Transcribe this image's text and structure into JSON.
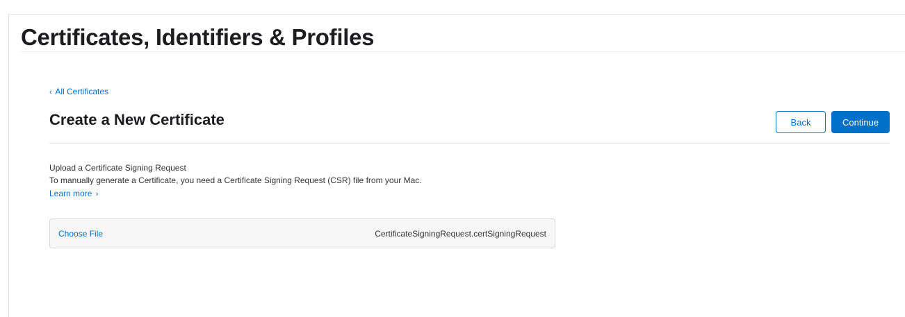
{
  "header": {
    "title": "Certificates, Identifiers & Profiles"
  },
  "breadcrumb": {
    "chevron": "‹",
    "label": "All Certificates"
  },
  "section": {
    "title": "Create a New Certificate"
  },
  "actions": {
    "back_label": "Back",
    "continue_label": "Continue"
  },
  "upload": {
    "heading": "Upload a Certificate Signing Request",
    "description": "To manually generate a Certificate, you need a Certificate Signing Request (CSR) file from your Mac.",
    "learn_more": "Learn more",
    "learn_more_chevron": "›",
    "choose_file_label": "Choose File",
    "file_name": "CertificateSigningRequest.certSigningRequest"
  },
  "colors": {
    "accent": "#0070c9",
    "title_text": "#1d1d1f",
    "body_text": "#333333"
  }
}
